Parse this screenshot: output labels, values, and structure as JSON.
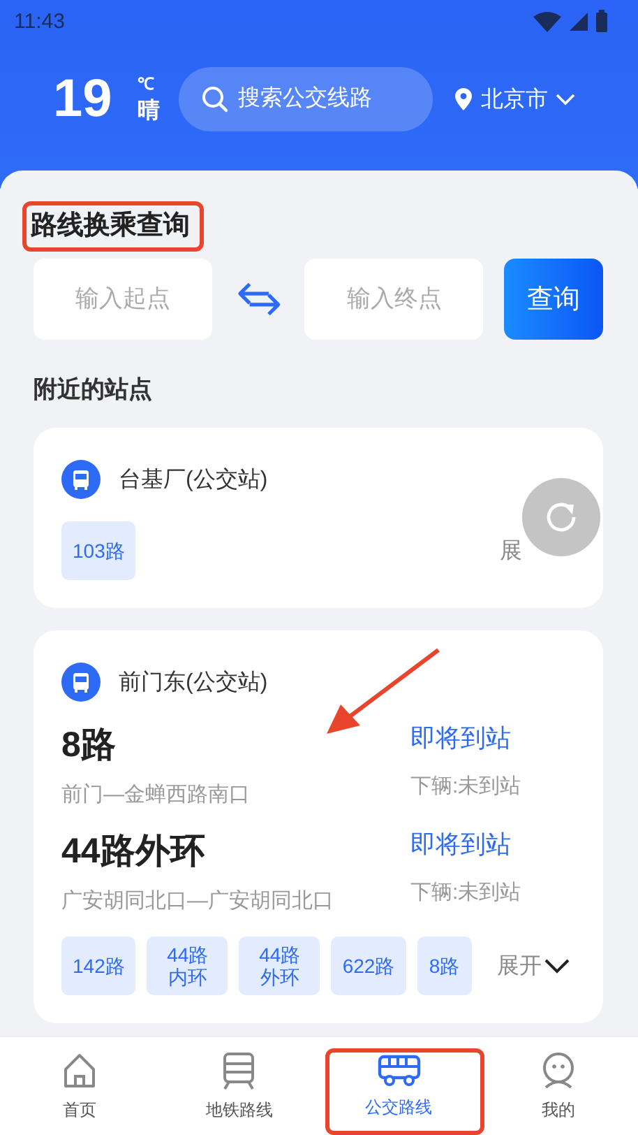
{
  "status_bar": {
    "time": "11:43"
  },
  "header": {
    "temperature": "19",
    "unit": "℃",
    "weather": "晴",
    "search": {
      "placeholder": "搜索公交线路"
    },
    "city": "北京市"
  },
  "route_query": {
    "title": "路线换乘查询",
    "annotated": true,
    "from": {
      "placeholder": "输入起点"
    },
    "to": {
      "placeholder": "输入终点"
    },
    "button": "查询"
  },
  "nearby": {
    "title": "附近的站点",
    "stations": [
      {
        "name": "台基厂(公交站)",
        "annotated": false,
        "routes": [
          "103路"
        ],
        "expand": "展"
      },
      {
        "name": "前门东(公交站)",
        "annotated": true,
        "lines": [
          {
            "name": "8路",
            "direction": "前门—金蝉西路南口",
            "status": "即将到站",
            "next": "下辆:未到站"
          },
          {
            "name": "44路外环",
            "direction": "广安胡同北口—广安胡同北口",
            "status": "即将到站",
            "next": "下辆:未到站"
          }
        ],
        "routes": [
          "142路",
          "44路内环",
          "44路外环",
          "622路",
          "8路"
        ],
        "expand": "展开"
      }
    ]
  },
  "nav": [
    {
      "label": "首页",
      "kind": "home",
      "selected": false,
      "annotated": false
    },
    {
      "label": "地铁路线",
      "kind": "subway",
      "selected": false,
      "annotated": false
    },
    {
      "label": "公交路线",
      "kind": "bus",
      "selected": true,
      "annotated": true
    },
    {
      "label": "我的",
      "kind": "profile",
      "selected": false,
      "annotated": false
    }
  ]
}
